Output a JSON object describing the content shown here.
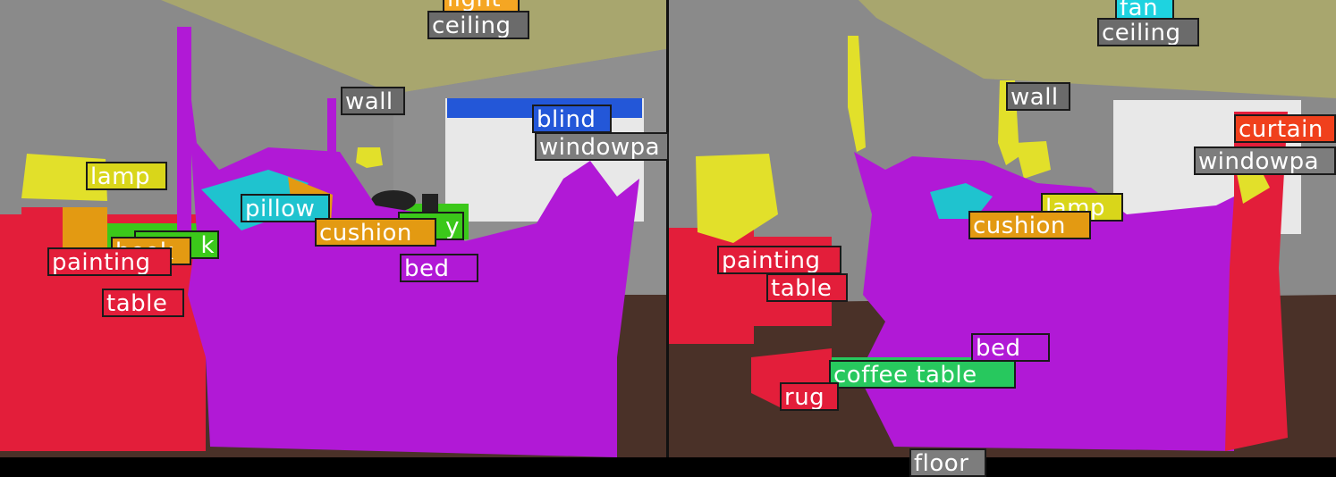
{
  "panels": [
    {
      "labels": [
        {
          "text": "light",
          "color": "#f5a623"
        },
        {
          "text": "ceiling",
          "color": "#6b6b6b"
        },
        {
          "text": "wall",
          "color": "#6b6b6b"
        },
        {
          "text": "blind",
          "color": "#2357d8"
        },
        {
          "text": "windowpa",
          "color": "#7d7d7d"
        },
        {
          "text": "lamp",
          "color": "#d9d61a"
        },
        {
          "text": "pillow",
          "color": "#1fc3cf"
        },
        {
          "text": "cushion",
          "color": "#e39a12"
        },
        {
          "text": "book",
          "color": "#e39a12"
        },
        {
          "text": "k",
          "color": "#3bc81a"
        },
        {
          "text": "y",
          "color": "#3bc81a"
        },
        {
          "text": "painting",
          "color": "#e31e3a"
        },
        {
          "text": "table",
          "color": "#e31e3a"
        },
        {
          "text": "bed",
          "color": "#b119d6"
        }
      ]
    },
    {
      "labels": [
        {
          "text": "fan",
          "color": "#1ed3e0"
        },
        {
          "text": "ceiling",
          "color": "#6b6b6b"
        },
        {
          "text": "wall",
          "color": "#6b6b6b"
        },
        {
          "text": "curtain",
          "color": "#f0401c"
        },
        {
          "text": "windowpa",
          "color": "#7d7d7d"
        },
        {
          "text": "lamp",
          "color": "#d9d61a"
        },
        {
          "text": "cushion",
          "color": "#e39a12"
        },
        {
          "text": "painting",
          "color": "#e31e3a"
        },
        {
          "text": "table",
          "color": "#e31e3a"
        },
        {
          "text": "bed",
          "color": "#b119d6"
        },
        {
          "text": "coffee table",
          "color": "#27c85e"
        },
        {
          "text": "rug",
          "color": "#e31e3a"
        },
        {
          "text": "floor",
          "color": "#7d7d7d"
        }
      ]
    }
  ]
}
